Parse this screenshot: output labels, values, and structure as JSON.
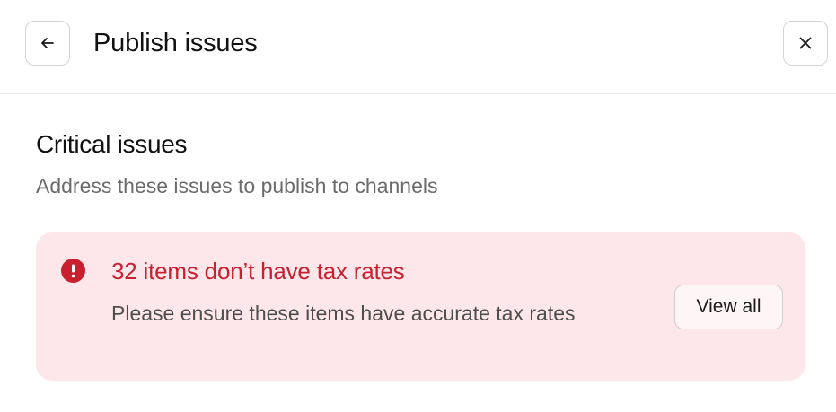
{
  "header": {
    "back_icon": "arrow-left-icon",
    "title": "Publish issues",
    "close_icon": "close-icon"
  },
  "section": {
    "title": "Critical issues",
    "subtitle": "Address these issues to publish to channels"
  },
  "issue": {
    "icon": "error-icon",
    "title": "32 items don’t have tax rates",
    "description": "Please ensure these items have accurate tax rates",
    "action_label": "View all",
    "colors": {
      "background": "#fde7ea",
      "title": "#c8202f",
      "icon": "#c8202f"
    }
  }
}
